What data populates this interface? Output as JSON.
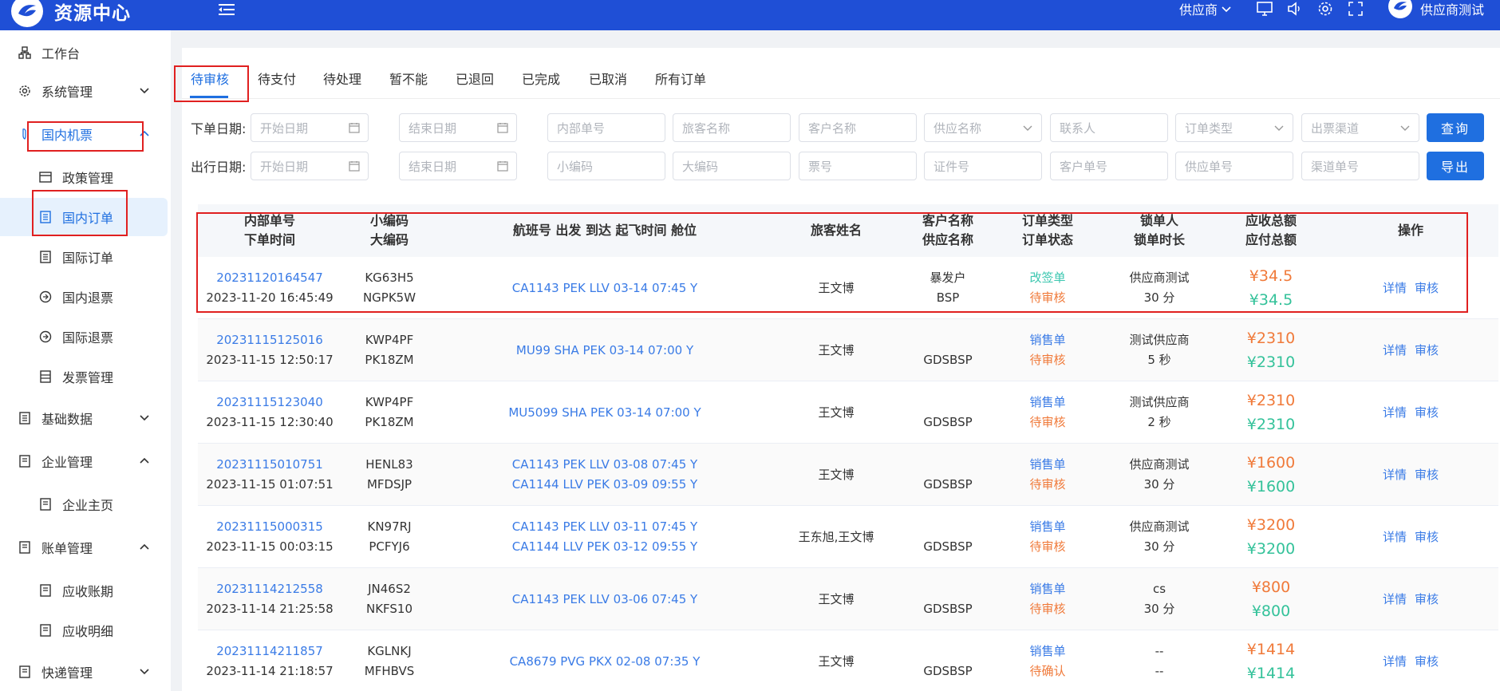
{
  "header": {
    "title": "资源中心",
    "supplier_menu": "供应商",
    "user_name": "供应商测试"
  },
  "sidebar": {
    "items": [
      {
        "label": "工作台",
        "icon": "workbench-icon"
      },
      {
        "label": "系统管理",
        "icon": "gear-icon"
      },
      {
        "label": "国内机票",
        "icon": "plane-icon"
      },
      {
        "label": "政策管理",
        "icon": "card-icon"
      },
      {
        "label": "国内订单",
        "icon": "doc-icon"
      },
      {
        "label": "国际订单",
        "icon": "doc-icon"
      },
      {
        "label": "国内退票",
        "icon": "refund-icon"
      },
      {
        "label": "国际退票",
        "icon": "refund-icon"
      },
      {
        "label": "发票管理",
        "icon": "invoice-icon"
      },
      {
        "label": "基础数据",
        "icon": "doc-icon"
      },
      {
        "label": "企业管理",
        "icon": "doc-icon"
      },
      {
        "label": "企业主页",
        "icon": "doc-icon"
      },
      {
        "label": "账单管理",
        "icon": "doc-icon"
      },
      {
        "label": "应收账期",
        "icon": "doc-icon"
      },
      {
        "label": "应收明细",
        "icon": "doc-icon"
      },
      {
        "label": "快递管理",
        "icon": "doc-icon"
      }
    ]
  },
  "tabs": [
    "待审核",
    "待支付",
    "待处理",
    "暂不能",
    "已退回",
    "已完成",
    "已取消",
    "所有订单"
  ],
  "filters": {
    "order_date_label": "下单日期:",
    "depart_date_label": "出行日期:",
    "start_date": "开始日期",
    "end_date": "结束日期",
    "row1": [
      "内部单号",
      "旅客名称",
      "客户名称",
      "供应名称",
      "联系人",
      "订单类型",
      "出票渠道"
    ],
    "row2": [
      "小编码",
      "大编码",
      "票号",
      "证件号",
      "客户单号",
      "供应单号",
      "渠道单号"
    ],
    "query_btn": "查询",
    "export_btn": "导出"
  },
  "table": {
    "headers": [
      [
        "内部单号",
        "下单时间"
      ],
      [
        "小编码",
        "大编码"
      ],
      [
        "航班号 出发 到达 起飞时间 舱位"
      ],
      [
        "旅客姓名"
      ],
      [
        "客户名称",
        "供应名称"
      ],
      [
        "订单类型",
        "订单状态"
      ],
      [
        "锁单人",
        "锁单时长"
      ],
      [
        "应收总额",
        "应付总额"
      ],
      [
        "操作"
      ]
    ],
    "rows": [
      {
        "order_no": "20231120164547",
        "time": "2023-11-20 16:45:49",
        "small": "KG63H5",
        "big": "NGPK5W",
        "flights": [
          "CA1143 PEK LLV 03-14 07:45 Y"
        ],
        "passenger": "王文博",
        "customer": "暴发户",
        "supplier": "BSP",
        "type": "改签单",
        "status": "待审核",
        "locker": "供应商测试",
        "lock_time": "30 分",
        "receivable": "¥34.5",
        "payable": "¥34.5"
      },
      {
        "order_no": "20231115125016",
        "time": "2023-11-15 12:50:17",
        "small": "KWP4PF",
        "big": "PK18ZM",
        "flights": [
          "MU99 SHA PEK 03-14 07:00 Y"
        ],
        "passenger": "王文博",
        "customer": "",
        "supplier": "GDSBSP",
        "type": "销售单",
        "status": "待审核",
        "locker": "测试供应商",
        "lock_time": "5 秒",
        "receivable": "¥2310",
        "payable": "¥2310"
      },
      {
        "order_no": "20231115123040",
        "time": "2023-11-15 12:30:40",
        "small": "KWP4PF",
        "big": "PK18ZM",
        "flights": [
          "MU5099 SHA PEK 03-14 07:00 Y"
        ],
        "passenger": "王文博",
        "customer": "",
        "supplier": "GDSBSP",
        "type": "销售单",
        "status": "待审核",
        "locker": "测试供应商",
        "lock_time": "2 秒",
        "receivable": "¥2310",
        "payable": "¥2310"
      },
      {
        "order_no": "20231115010751",
        "time": "2023-11-15 01:07:51",
        "small": "HENL83",
        "big": "MFDSJP",
        "flights": [
          "CA1143 PEK LLV 03-08 07:45 Y",
          "CA1144 LLV PEK 03-09 09:55 Y"
        ],
        "passenger": "王文博",
        "customer": "",
        "supplier": "GDSBSP",
        "type": "销售单",
        "status": "待审核",
        "locker": "供应商测试",
        "lock_time": "30 分",
        "receivable": "¥1600",
        "payable": "¥1600"
      },
      {
        "order_no": "20231115000315",
        "time": "2023-11-15 00:03:15",
        "small": "KN97RJ",
        "big": "PCFYJ6",
        "flights": [
          "CA1143 PEK LLV 03-11 07:45 Y",
          "CA1144 LLV PEK 03-12 09:55 Y"
        ],
        "passenger": "王东旭,王文博",
        "customer": "",
        "supplier": "GDSBSP",
        "type": "销售单",
        "status": "待审核",
        "locker": "供应商测试",
        "lock_time": "30 分",
        "receivable": "¥3200",
        "payable": "¥3200"
      },
      {
        "order_no": "20231114212558",
        "time": "2023-11-14 21:25:58",
        "small": "JN46S2",
        "big": "NKFS10",
        "flights": [
          "CA1143 PEK LLV 03-06 07:45 Y"
        ],
        "passenger": "王文博",
        "customer": "",
        "supplier": "GDSBSP",
        "type": "销售单",
        "status": "待审核",
        "locker": "cs",
        "lock_time": "30 分",
        "receivable": "¥800",
        "payable": "¥800"
      },
      {
        "order_no": "20231114211857",
        "time": "2023-11-14 21:18:57",
        "small": "KGLNKJ",
        "big": "MFHBVS",
        "flights": [
          "CA8679 PVG PKX 02-08 07:35 Y"
        ],
        "passenger": "王文博",
        "customer": "",
        "supplier": "GDSBSP",
        "type": "销售单",
        "status": "待确认",
        "locker": "--",
        "lock_time": "--",
        "receivable": "¥1414",
        "payable": "¥1414"
      }
    ],
    "detail_label": "详情",
    "audit_label": "审核"
  },
  "colors": {
    "header_bg": "#1f4fd6",
    "accent": "#1f6fe0",
    "highlight": "#e02020",
    "orange": "#f07a3a",
    "green": "#34c29a"
  }
}
